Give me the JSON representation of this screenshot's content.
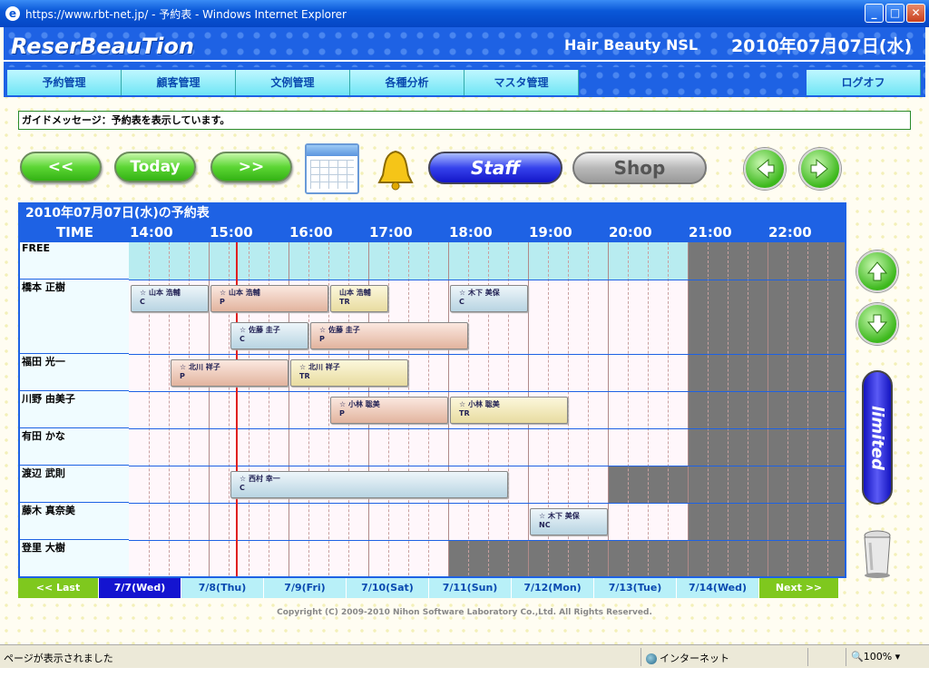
{
  "window": {
    "title": "https://www.rbt-net.jp/ - 予約表 - Windows Internet Explorer"
  },
  "header": {
    "logo": "ReserBeauTion",
    "shop": "Hair Beauty NSL",
    "date": "2010年07月07日(水)"
  },
  "nav": {
    "items": [
      "予約管理",
      "顧客管理",
      "文例管理",
      "各種分析",
      "マスタ管理"
    ],
    "logout": "ログオフ"
  },
  "guide": "ガイドメッセージ：予約表を表示しています。",
  "toolbar": {
    "prev": "<<",
    "today": "Today",
    "next": ">>",
    "staff": "Staff",
    "shop": "Shop"
  },
  "schedule": {
    "title": "2010年07月07日(水)の予約表",
    "time_label": "TIME",
    "hours": [
      "14:00",
      "15:00",
      "16:00",
      "17:00",
      "18:00",
      "19:00",
      "20:00",
      "21:00",
      "22:00"
    ],
    "rows": [
      "FREE",
      "橋本 正樹",
      "福田 光一",
      "川野 由美子",
      "有田 かな",
      "渡辺 武則",
      "藤木 真奈美",
      "登里 大樹"
    ],
    "bookings": [
      {
        "name": "☆ 山本 浩輔",
        "code": "C"
      },
      {
        "name": "☆ 山本 浩輔",
        "code": "P"
      },
      {
        "name": "山本 浩輔",
        "code": "TR"
      },
      {
        "name": "☆ 木下 美保",
        "code": "C"
      },
      {
        "name": "☆ 佐藤 圭子",
        "code": "C"
      },
      {
        "name": "☆ 佐藤 圭子",
        "code": "P"
      },
      {
        "name": "☆ 北川 祥子",
        "code": "P"
      },
      {
        "name": "☆ 北川 祥子",
        "code": "TR"
      },
      {
        "name": "☆ 小林 聡美",
        "code": "P"
      },
      {
        "name": "☆ 小林 聡美",
        "code": "TR"
      },
      {
        "name": "☆ 西村 幸一",
        "code": "C"
      },
      {
        "name": "☆ 木下 美保",
        "code": "NC"
      }
    ]
  },
  "days": {
    "last": "<< Last",
    "list": [
      "7/7(Wed)",
      "7/8(Thu)",
      "7/9(Fri)",
      "7/10(Sat)",
      "7/11(Sun)",
      "7/12(Mon)",
      "7/13(Tue)",
      "7/14(Wed)"
    ],
    "next": "Next >>"
  },
  "side": {
    "limited": "limited"
  },
  "copyright": "Copyright (C) 2009-2010 Nihon Software Laboratory Co.,Ltd. All Rights Reserved.",
  "status": {
    "text": "ページが表示されました",
    "zone": "インターネット",
    "zoom": "100%"
  }
}
